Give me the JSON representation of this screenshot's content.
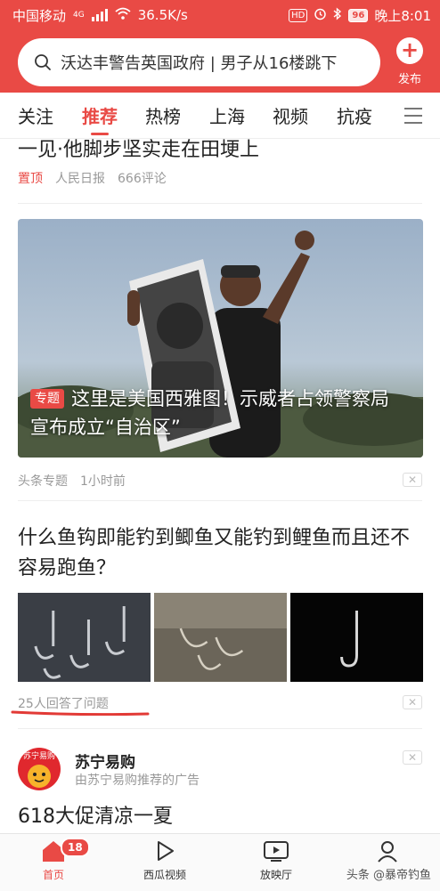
{
  "status_bar": {
    "carrier": "中国移动",
    "network": "4G",
    "speed": "36.5K/s",
    "hd_label": "HD",
    "battery": "96",
    "time": "晚上8:01"
  },
  "search": {
    "query": "沃达丰警告英国政府 | 男子从16楼跳下",
    "publish_label": "发布"
  },
  "tabs": [
    "关注",
    "推荐",
    "热榜",
    "上海",
    "视频",
    "抗疫"
  ],
  "active_tab": "推荐",
  "feed": {
    "top_story": {
      "title": "一见·他脚步坚实走在田埂上",
      "pin": "置顶",
      "source": "人民日报",
      "comments": "666评论"
    },
    "feature": {
      "tag": "专题",
      "headline": "这里是美国西雅图！示威者占领警察局 宣布成立“自治区”",
      "source": "头条专题",
      "time": "1小时前",
      "close": "✕"
    },
    "qa": {
      "title": "什么鱼钩即能钓到鲫鱼又能钓到鲤鱼而且还不容易跑鱼？",
      "answers": "25人回答了问题",
      "close": "✕"
    },
    "ad": {
      "logo_text": "苏宁易购",
      "advertiser": "苏宁易购",
      "subtitle": "由苏宁易购推荐的广告",
      "headline": "618大促清凉一夏",
      "close": "✕"
    }
  },
  "bottom_nav": {
    "items": [
      "首页",
      "西瓜视频",
      "放映厅",
      "我的"
    ],
    "active": "首页",
    "home_badge": "18"
  },
  "watermark": "头条 @暴帝钓鱼",
  "colors": {
    "accent": "#e94a45",
    "meta_text": "#999999"
  }
}
